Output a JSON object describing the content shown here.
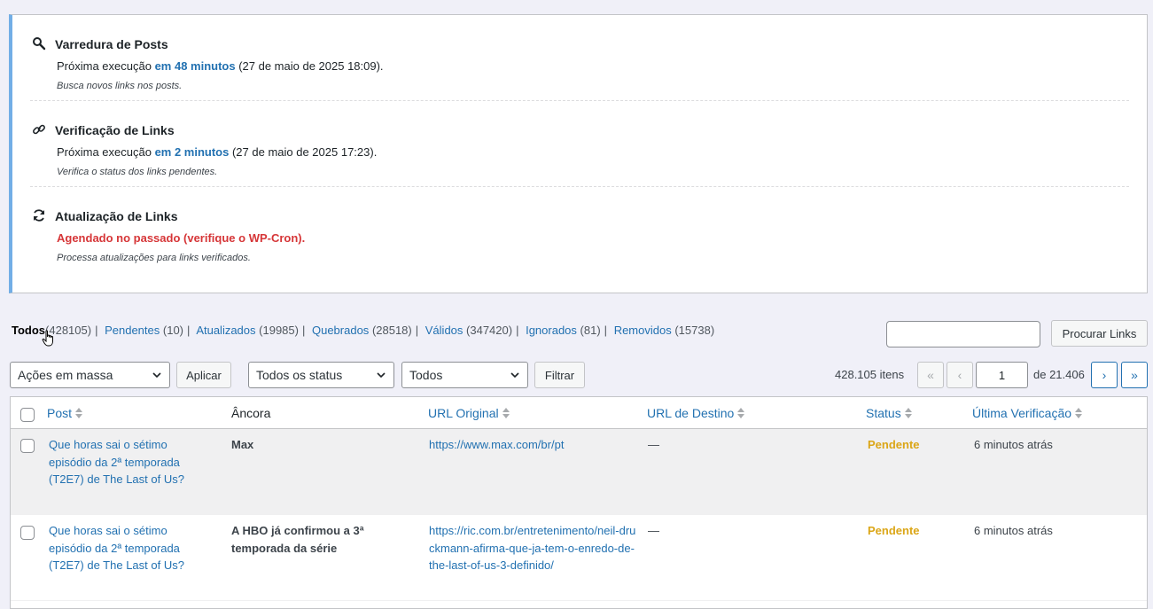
{
  "tasks": [
    {
      "title": "Varredura de Posts",
      "next_prefix": "Próxima execução ",
      "next_link": "em 48 minutos",
      "next_suffix": " (27 de maio de 2025 18:09).",
      "desc": "Busca novos links nos posts.",
      "icon": "search-icon"
    },
    {
      "title": "Verificação de Links",
      "next_prefix": "Próxima execução ",
      "next_link": "em 2 minutos",
      "next_suffix": " (27 de maio de 2025 17:23).",
      "desc": "Verifica o status dos links pendentes.",
      "icon": "link-icon"
    },
    {
      "title": "Atualização de Links",
      "warning": "Agendado no passado (verifique o WP-Cron).",
      "desc": "Processa atualizações para links verificados.",
      "icon": "refresh-icon"
    }
  ],
  "filters": [
    {
      "label": "Todos",
      "count": "(428105)"
    },
    {
      "label": "Pendentes",
      "count": "(10)"
    },
    {
      "label": "Atualizados",
      "count": "(19985)"
    },
    {
      "label": "Quebrados",
      "count": "(28518)"
    },
    {
      "label": "Válidos",
      "count": "(347420)"
    },
    {
      "label": "Ignorados",
      "count": "(81)"
    },
    {
      "label": "Removidos",
      "count": "(15738)"
    }
  ],
  "search": {
    "button": "Procurar Links",
    "value": ""
  },
  "toolbar": {
    "bulk": "Ações em massa",
    "apply": "Aplicar",
    "status": "Todos os status",
    "type": "Todos",
    "filter": "Filtrar"
  },
  "pagination": {
    "items": "428.105 itens",
    "first": "«",
    "prev": "‹",
    "page": "1",
    "of": "de 21.406",
    "next": "›",
    "last": "»"
  },
  "columns": {
    "post": "Post",
    "anchor": "Âncora",
    "url": "URL Original",
    "dest": "URL de Destino",
    "status": "Status",
    "checked": "Última Verificação"
  },
  "rows": [
    {
      "post": "Que horas sai o sétimo episódio da 2ª temporada (T2E7) de The Last of Us?",
      "anchor": "Max",
      "url": "https://www.max.com/br/pt",
      "dest": "—",
      "status": "Pendente",
      "checked": "6 minutos atrás"
    },
    {
      "post": "Que horas sai o sétimo episódio da 2ª temporada (T2E7) de The Last of Us?",
      "anchor": "A HBO já confirmou a 3ª temporada da série",
      "url": "https://ric.com.br/entretenimento/neil-druckmann-afirma-que-ja-tem-o-enredo-de-the-last-of-us-3-definido/",
      "dest": "—",
      "status": "Pendente",
      "checked": "6 minutos atrás"
    }
  ]
}
